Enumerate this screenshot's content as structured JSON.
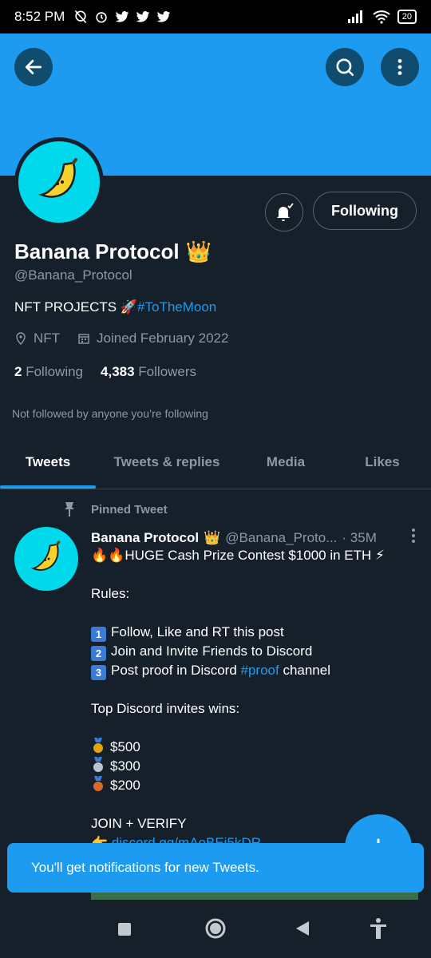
{
  "status_bar": {
    "time": "8:52 PM",
    "battery": "20"
  },
  "profile": {
    "name": "Banana Protocol",
    "name_emoji": "👑",
    "handle": "@Banana_Protocol",
    "bio_text": "NFT PROJECTS 🚀",
    "bio_hashtag": "#ToTheMoon",
    "location": "NFT",
    "joined": "Joined February 2022",
    "following_count": "2",
    "following_label": "Following",
    "followers_count": "4,383",
    "followers_label": "Followers",
    "not_followed": "Not followed by anyone you’re following",
    "follow_button": "Following"
  },
  "tabs": [
    {
      "label": "Tweets",
      "active": true
    },
    {
      "label": "Tweets & replies",
      "active": false
    },
    {
      "label": "Media",
      "active": false
    },
    {
      "label": "Likes",
      "active": false
    }
  ],
  "tweet": {
    "pinned_label": "Pinned Tweet",
    "author": "Banana Protocol",
    "author_emoji": "👑",
    "handle": "@Banana_Proto...",
    "time": "· 35M",
    "headline": "🔥🔥HUGE Cash Prize Contest $1000 in ETH ⚡",
    "rules_label": "Rules:",
    "rule1_num": "1",
    "rule1": "Follow, Like and RT this post",
    "rule2_num": "2",
    "rule2": "Join and Invite Friends to Discord",
    "rule3_num": "3",
    "rule3_prefix": "Post proof in Discord ",
    "rule3_hashtag": "#proof",
    "rule3_suffix": " channel",
    "top_invites": "Top Discord invites wins:",
    "prize1": "$500",
    "prize2": "$300",
    "prize3": "$200",
    "join_line": "JOIN + VERIFY",
    "link_line": "discord.gg/mAoBEj5kDR"
  },
  "toast": {
    "text": "You'll get notifications for new Tweets."
  },
  "colors": {
    "accent": "#1d9bf0",
    "background": "#15202b",
    "avatar_bg": "#00d9ec"
  },
  "icons": {
    "back": "arrow-left-icon",
    "search": "search-icon",
    "more": "more-vertical-icon",
    "bell": "bell-check-icon",
    "location": "location-pin-icon",
    "calendar": "calendar-icon",
    "pin": "pin-icon",
    "compose": "plus-icon"
  }
}
